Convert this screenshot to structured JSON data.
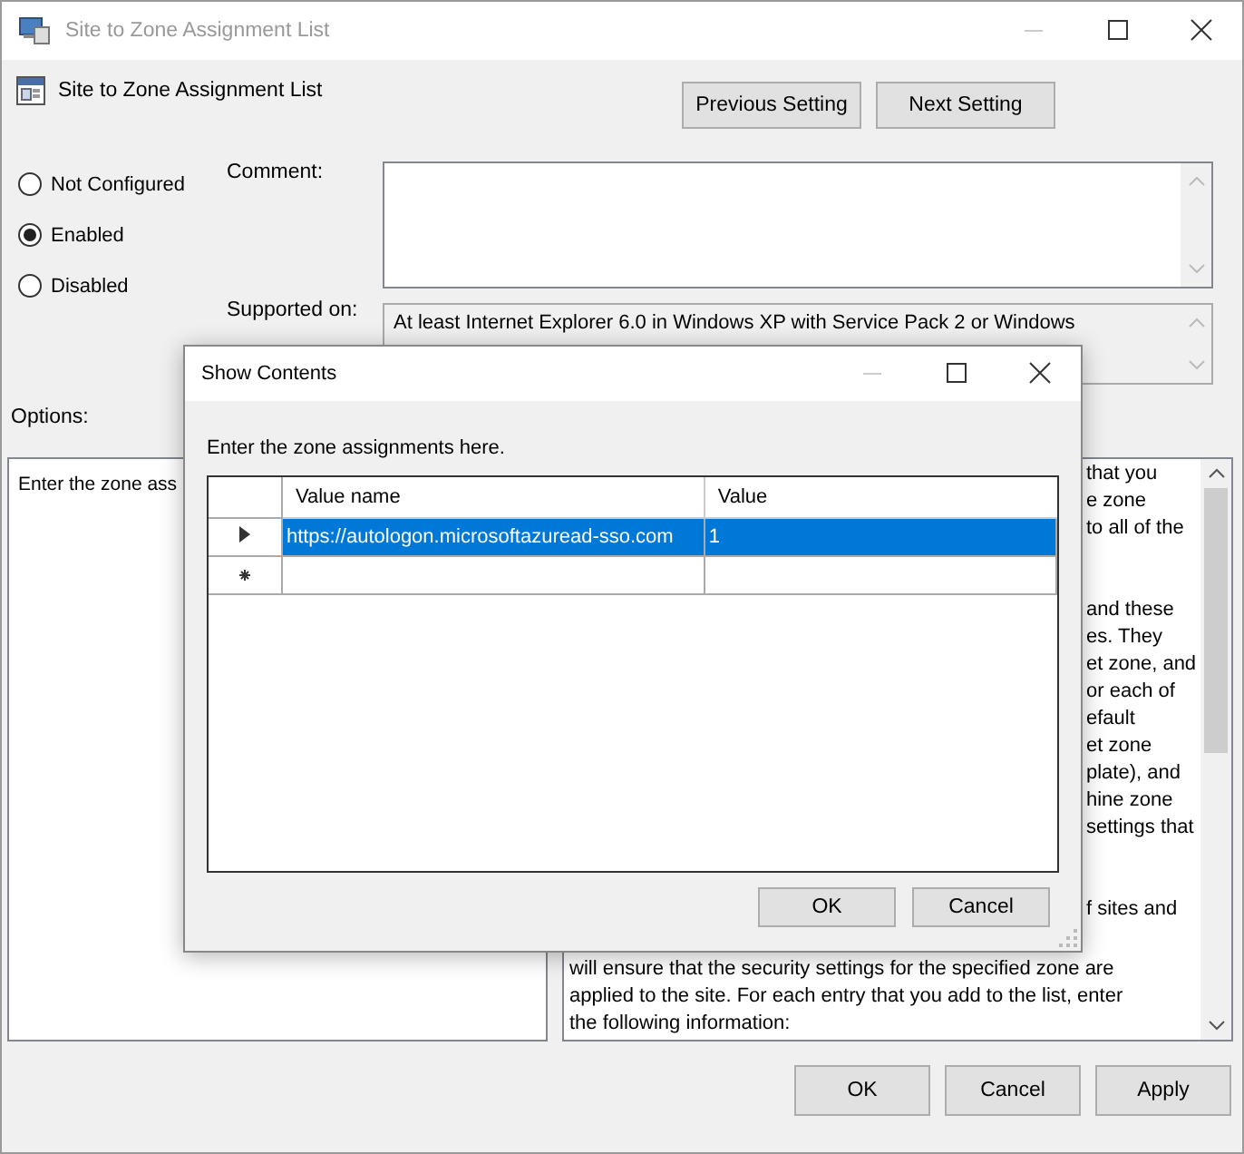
{
  "window": {
    "title": "Site to Zone Assignment List"
  },
  "header": {
    "title": "Site to Zone Assignment List",
    "buttons": [
      "Previous Setting",
      "Next Setting"
    ]
  },
  "state_options": [
    {
      "label": "Not Configured",
      "selected": false
    },
    {
      "label": "Enabled",
      "selected": true
    },
    {
      "label": "Disabled",
      "selected": false
    }
  ],
  "comment": {
    "label": "Comment:"
  },
  "supported_on": {
    "label": "Supported on:",
    "value": "At least Internet Explorer 6.0 in Windows XP with Service Pack 2 or Windows"
  },
  "options": {
    "label": "Options:",
    "panel_text": "Enter the zone ass"
  },
  "help": {
    "paragraphs": [
      [
        "that you",
        "e zone",
        "to all of the"
      ],
      [
        "and these",
        "es. They",
        "et zone, and",
        "or each of",
        "efault",
        "et zone",
        "plate), and",
        "hine zone",
        "settings that"
      ],
      [
        "f sites and"
      ],
      [
        "will ensure that the security settings for the specified zone are",
        "applied to the site.  For each entry that you add to the list, enter",
        "the following information:"
      ]
    ]
  },
  "buttons": [
    "OK",
    "Cancel",
    "Apply"
  ],
  "dialog": {
    "title": "Show Contents",
    "prompt": "Enter the zone assignments here.",
    "columns": [
      "Value name",
      "Value"
    ],
    "rows": [
      {
        "kind": "entry",
        "name": "https://autologon.microsoftazuread-sso.com",
        "value": "1",
        "selected": true
      },
      {
        "kind": "new",
        "name": "",
        "value": "",
        "selected": false
      }
    ],
    "buttons": [
      "OK",
      "Cancel"
    ]
  }
}
